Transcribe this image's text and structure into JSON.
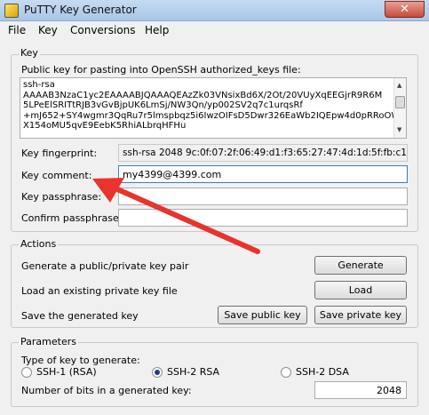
{
  "window": {
    "title": "PuTTY Key Generator",
    "close_glyph": "✕"
  },
  "menu": {
    "items": [
      "File",
      "Key",
      "Conversions",
      "Help"
    ]
  },
  "key_group": {
    "label": "Key",
    "public_key_label": "Public key for pasting into OpenSSH authorized_keys file:",
    "public_key_text": "ssh-rsa\nAAAAB3NzaC1yc2EAAAABJQAAAQEAzZk03VNsixBd6X/2Ot/20VUyXqEEGjrR9R6M\n5LPeElSRITtRJB3vGvBjpUK6LmSj/NW3Qn/yp002SV2q7c1urqsRf\n+mJ652+SY4wgmr3QqRu7r5lmspbqz5i6IwzOIFsD5Dwr326EaWb2IQEpw4d0pRRoOW\nX154oMU5qvE9EebK5RhiALbrqHFHu",
    "fingerprint_label": "Key fingerprint:",
    "fingerprint_value": "ssh-rsa 2048 9c:0f:07:2f:06:49:d1:f3:65:27:47:4d:1d:5f:fb:c1",
    "comment_label": "Key comment:",
    "comment_value": "my4399@4399.com",
    "passphrase_label": "Key passphrase:",
    "confirm_label": "Confirm passphrase:"
  },
  "actions_group": {
    "label": "Actions",
    "generate_text": "Generate a public/private key pair",
    "generate_button": "Generate",
    "load_text": "Load an existing private key file",
    "load_button": "Load",
    "save_text": "Save the generated key",
    "save_public_button": "Save public key",
    "save_private_button": "Save private key"
  },
  "parameters_group": {
    "label": "Parameters",
    "type_label": "Type of key to generate:",
    "options": [
      "SSH-1 (RSA)",
      "SSH-2 RSA",
      "SSH-2 DSA"
    ],
    "selected_option": "SSH-2 RSA",
    "bits_label": "Number of bits in a generated key:",
    "bits_value": "2048"
  },
  "colors": {
    "arrow": "#e8342c",
    "titlebar": "#b9d1ee",
    "close": "#c74b3a"
  }
}
